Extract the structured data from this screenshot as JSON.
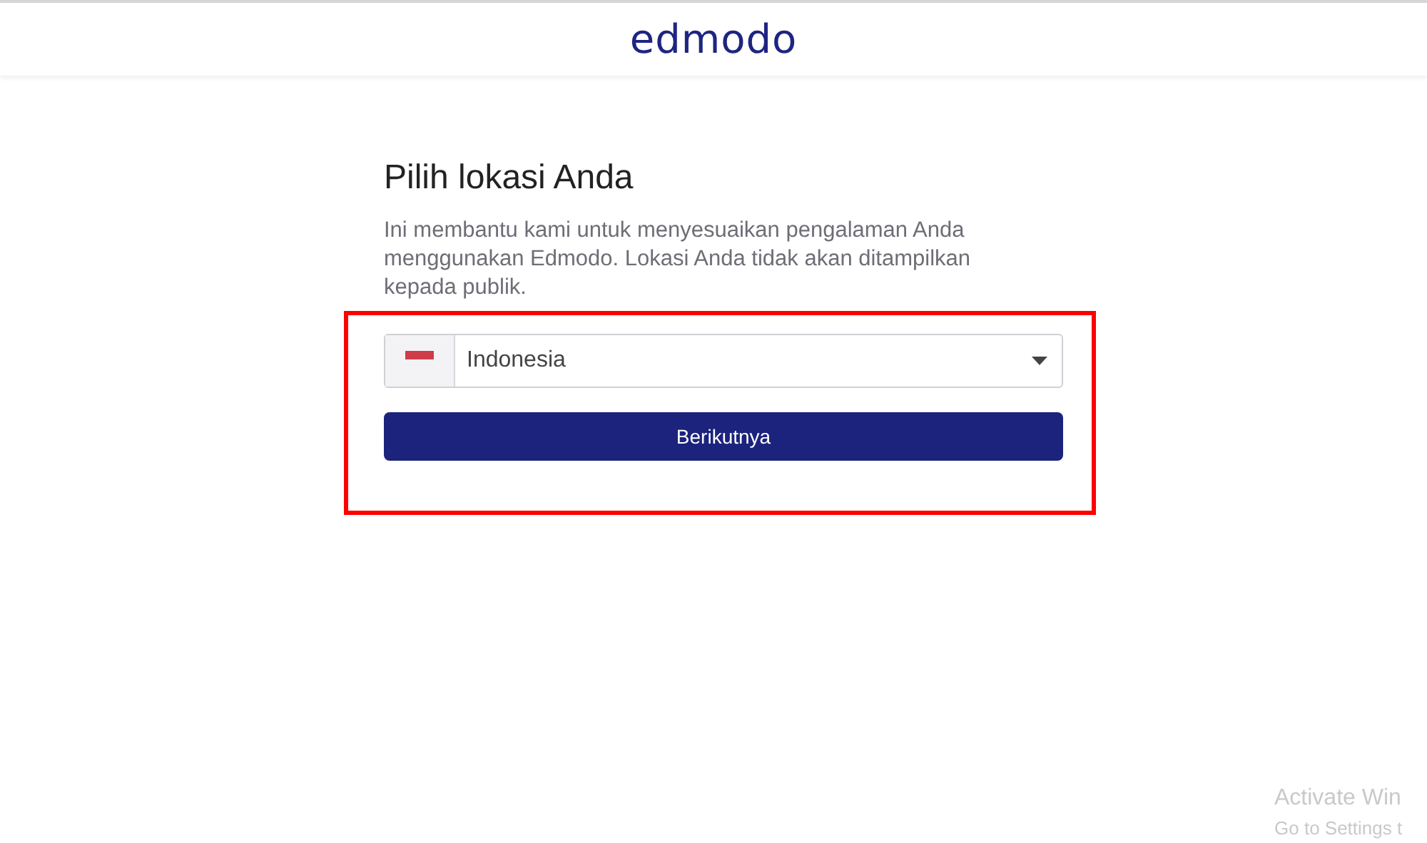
{
  "header": {
    "logo": "edmodo"
  },
  "form": {
    "title": "Pilih lokasi Anda",
    "description": "Ini membantu kami untuk menyesuaikan pengalaman Anda menggunakan Edmodo. Lokasi Anda tidak akan ditampilkan kepada publik.",
    "country_select": {
      "value": "Indonesia"
    },
    "submit_button": "Berikutnya"
  },
  "os_overlay": {
    "title": "Activate Win",
    "subtitle": "Go to Settings t"
  }
}
